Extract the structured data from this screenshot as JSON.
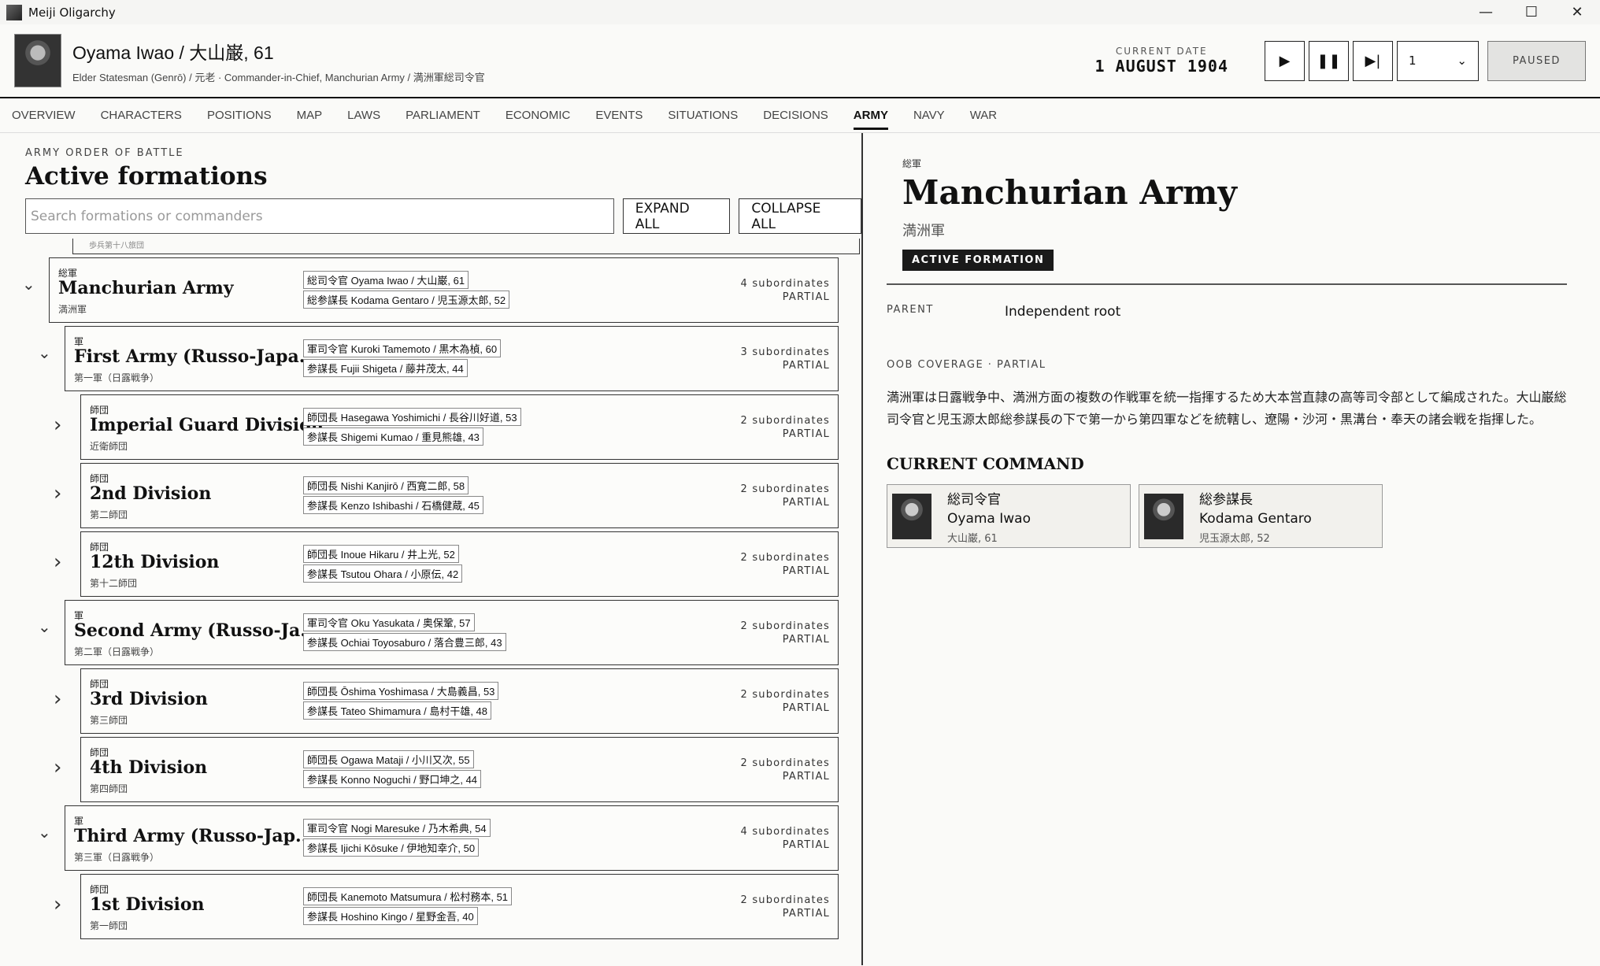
{
  "window": {
    "title": "Meiji Oligarchy",
    "minimize": "—",
    "maximize": "☐",
    "close": "✕"
  },
  "header": {
    "name": "Oyama Iwao  /  大山巌, 61",
    "subtitle": "Elder Statesman (Genrō)  /  元老 · Commander-in-Chief, Manchurian Army  /  満洲軍総司令官",
    "date_label": "CURRENT DATE",
    "date_value": "1 AUGUST 1904",
    "speed": "1",
    "status": "PAUSED"
  },
  "tabs": [
    "OVERVIEW",
    "CHARACTERS",
    "POSITIONS",
    "MAP",
    "LAWS",
    "PARLIAMENT",
    "ECONOMIC",
    "EVENTS",
    "SITUATIONS",
    "DECISIONS",
    "ARMY",
    "NAVY",
    "WAR"
  ],
  "active_tab": "ARMY",
  "left": {
    "kicker": "ARMY ORDER OF BATTLE",
    "title": "Active formations",
    "search_placeholder": "Search formations or commanders",
    "expand_all": "EXPAND ALL",
    "collapse_all": "COLLAPSE ALL",
    "clipped_row": "歩兵第十八旅団"
  },
  "formations": [
    {
      "level": 0,
      "expanded": true,
      "type": "総軍",
      "name": "Manchurian Army",
      "jp": "満洲軍",
      "cmd1": "総司令官 Oyama Iwao / 大山巌, 61",
      "cmd2": "総参謀長 Kodama Gentaro / 児玉源太郎, 52",
      "subs": "4 subordinates",
      "status": "PARTIAL"
    },
    {
      "level": 1,
      "expanded": true,
      "type": "軍",
      "name": "First Army (Russo-Japa...",
      "jp": "第一軍（日露戦争）",
      "cmd1": "軍司令官 Kuroki Tamemoto / 黒木為楨, 60",
      "cmd2": "参謀長 Fujii Shigeta / 藤井茂太, 44",
      "subs": "3 subordinates",
      "status": "PARTIAL"
    },
    {
      "level": 2,
      "expanded": false,
      "type": "師団",
      "name": "Imperial Guard Division",
      "jp": "近衛師団",
      "cmd1": "師団長 Hasegawa Yoshimichi / 長谷川好道, 53",
      "cmd2": "参謀長 Shigemi Kumao / 重見熊雄, 43",
      "subs": "2 subordinates",
      "status": "PARTIAL"
    },
    {
      "level": 2,
      "expanded": false,
      "type": "師団",
      "name": "2nd Division",
      "jp": "第二師団",
      "cmd1": "師団長 Nishi Kanjirō / 西寛二郎, 58",
      "cmd2": "参謀長 Kenzo Ishibashi / 石橋健蔵, 45",
      "subs": "2 subordinates",
      "status": "PARTIAL"
    },
    {
      "level": 2,
      "expanded": false,
      "type": "師団",
      "name": "12th Division",
      "jp": "第十二師団",
      "cmd1": "師団長 Inoue Hikaru / 井上光, 52",
      "cmd2": "参謀長 Tsutou Ohara / 小原伝, 42",
      "subs": "2 subordinates",
      "status": "PARTIAL"
    },
    {
      "level": 1,
      "expanded": true,
      "type": "軍",
      "name": "Second Army (Russo-Ja...",
      "jp": "第二軍（日露戦争）",
      "cmd1": "軍司令官 Oku Yasukata / 奥保鞏, 57",
      "cmd2": "参謀長 Ochiai Toyosaburo / 落合豊三郎, 43",
      "subs": "2 subordinates",
      "status": "PARTIAL"
    },
    {
      "level": 2,
      "expanded": false,
      "type": "師団",
      "name": "3rd Division",
      "jp": "第三師団",
      "cmd1": "師団長 Ōshima Yoshimasa / 大島義昌, 53",
      "cmd2": "参謀長 Tateo Shimamura / 島村干雄, 48",
      "subs": "2 subordinates",
      "status": "PARTIAL"
    },
    {
      "level": 2,
      "expanded": false,
      "type": "師団",
      "name": "4th Division",
      "jp": "第四師団",
      "cmd1": "師団長 Ogawa Mataji / 小川又次, 55",
      "cmd2": "参謀長 Konno Noguchi / 野口坤之, 44",
      "subs": "2 subordinates",
      "status": "PARTIAL"
    },
    {
      "level": 1,
      "expanded": true,
      "type": "軍",
      "name": "Third Army (Russo-Jap...",
      "jp": "第三軍（日露戦争）",
      "cmd1": "軍司令官 Nogi Maresuke / 乃木希典, 54",
      "cmd2": "参謀長 Ijichi Kōsuke / 伊地知幸介, 50",
      "subs": "4 subordinates",
      "status": "PARTIAL"
    },
    {
      "level": 2,
      "expanded": false,
      "type": "師団",
      "name": "1st Division",
      "jp": "第一師団",
      "cmd1": "師団長 Kanemoto Matsumura / 松村務本, 51",
      "cmd2": "参謀長 Hoshino Kingo / 星野金吾, 40",
      "subs": "2 subordinates",
      "status": "PARTIAL"
    }
  ],
  "detail": {
    "kicker": "総軍",
    "title": "Manchurian Army",
    "jp": "満洲軍",
    "badge": "ACTIVE FORMATION",
    "parent_label": "PARENT",
    "parent_value": "Independent root",
    "coverage": "OOB COVERAGE · PARTIAL",
    "description": "満洲軍は日露戦争中、満洲方面の複数の作戦軍を統一指揮するため大本営直隷の高等司令部として編成された。大山巌総司令官と児玉源太郎総参謀長の下で第一から第四軍などを統轄し、遼陽・沙河・黒溝台・奉天の諸会戦を指揮した。",
    "command_title": "CURRENT COMMAND",
    "commanders": [
      {
        "role": "総司令官",
        "name": "Oyama Iwao",
        "jp": "大山巌, 61"
      },
      {
        "role": "総参謀長",
        "name": "Kodama Gentaro",
        "jp": "児玉源太郎, 52"
      }
    ]
  }
}
